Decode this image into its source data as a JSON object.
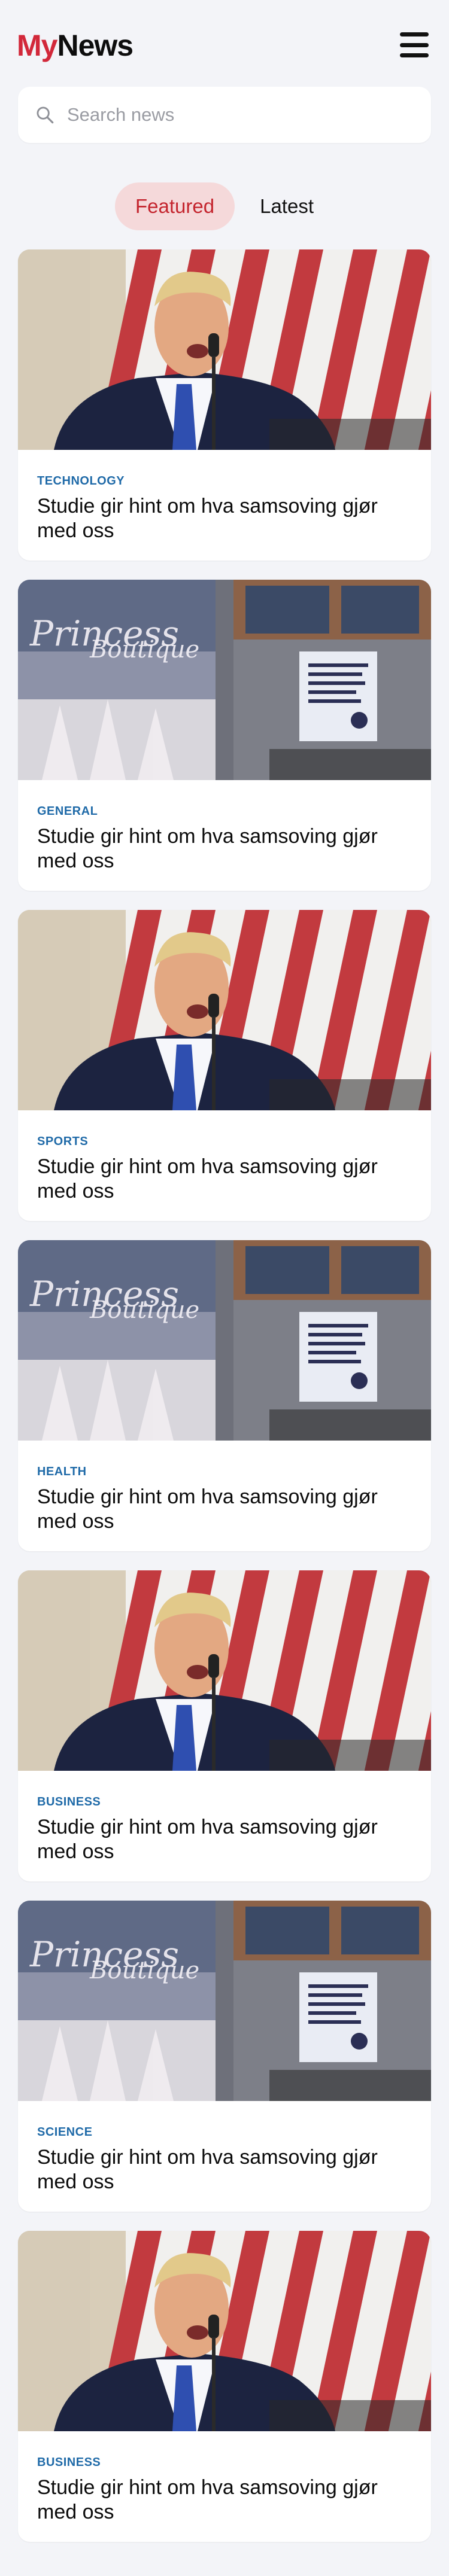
{
  "header": {
    "logo_my": "My",
    "logo_news": "News",
    "brand_color": "#d2283a",
    "menu_icon": "hamburger-menu-icon"
  },
  "search": {
    "placeholder": "Search news",
    "value": "",
    "icon": "search-icon"
  },
  "tabs": [
    {
      "label": "Featured",
      "active": true
    },
    {
      "label": "Latest",
      "active": false
    }
  ],
  "colors": {
    "category": "#1f6aa8",
    "tab_active_bg": "#f5d9da",
    "tab_active_text": "#c4252e",
    "page_bg": "#f3f4f8"
  },
  "articles": [
    {
      "category": "TECHNOLOGY",
      "title": "Studie gir hint om hva samsoving gjør med oss",
      "image": "speaker-at-podium"
    },
    {
      "category": "GENERAL",
      "title": "Studie gir hint om hva samsoving gjør med oss",
      "image": "boutique-storefront"
    },
    {
      "category": "SPORTS",
      "title": "Studie gir hint om hva samsoving gjør med oss",
      "image": "speaker-at-podium"
    },
    {
      "category": "HEALTH",
      "title": "Studie gir hint om hva samsoving gjør med oss",
      "image": "boutique-storefront"
    },
    {
      "category": "BUSINESS",
      "title": "Studie gir hint om hva samsoving gjør med oss",
      "image": "speaker-at-podium"
    },
    {
      "category": "SCIENCE",
      "title": "Studie gir hint om hva samsoving gjør med oss",
      "image": "boutique-storefront"
    },
    {
      "category": "BUSINESS",
      "title": "Studie gir hint om hva samsoving gjør med oss",
      "image": "speaker-at-podium"
    }
  ]
}
